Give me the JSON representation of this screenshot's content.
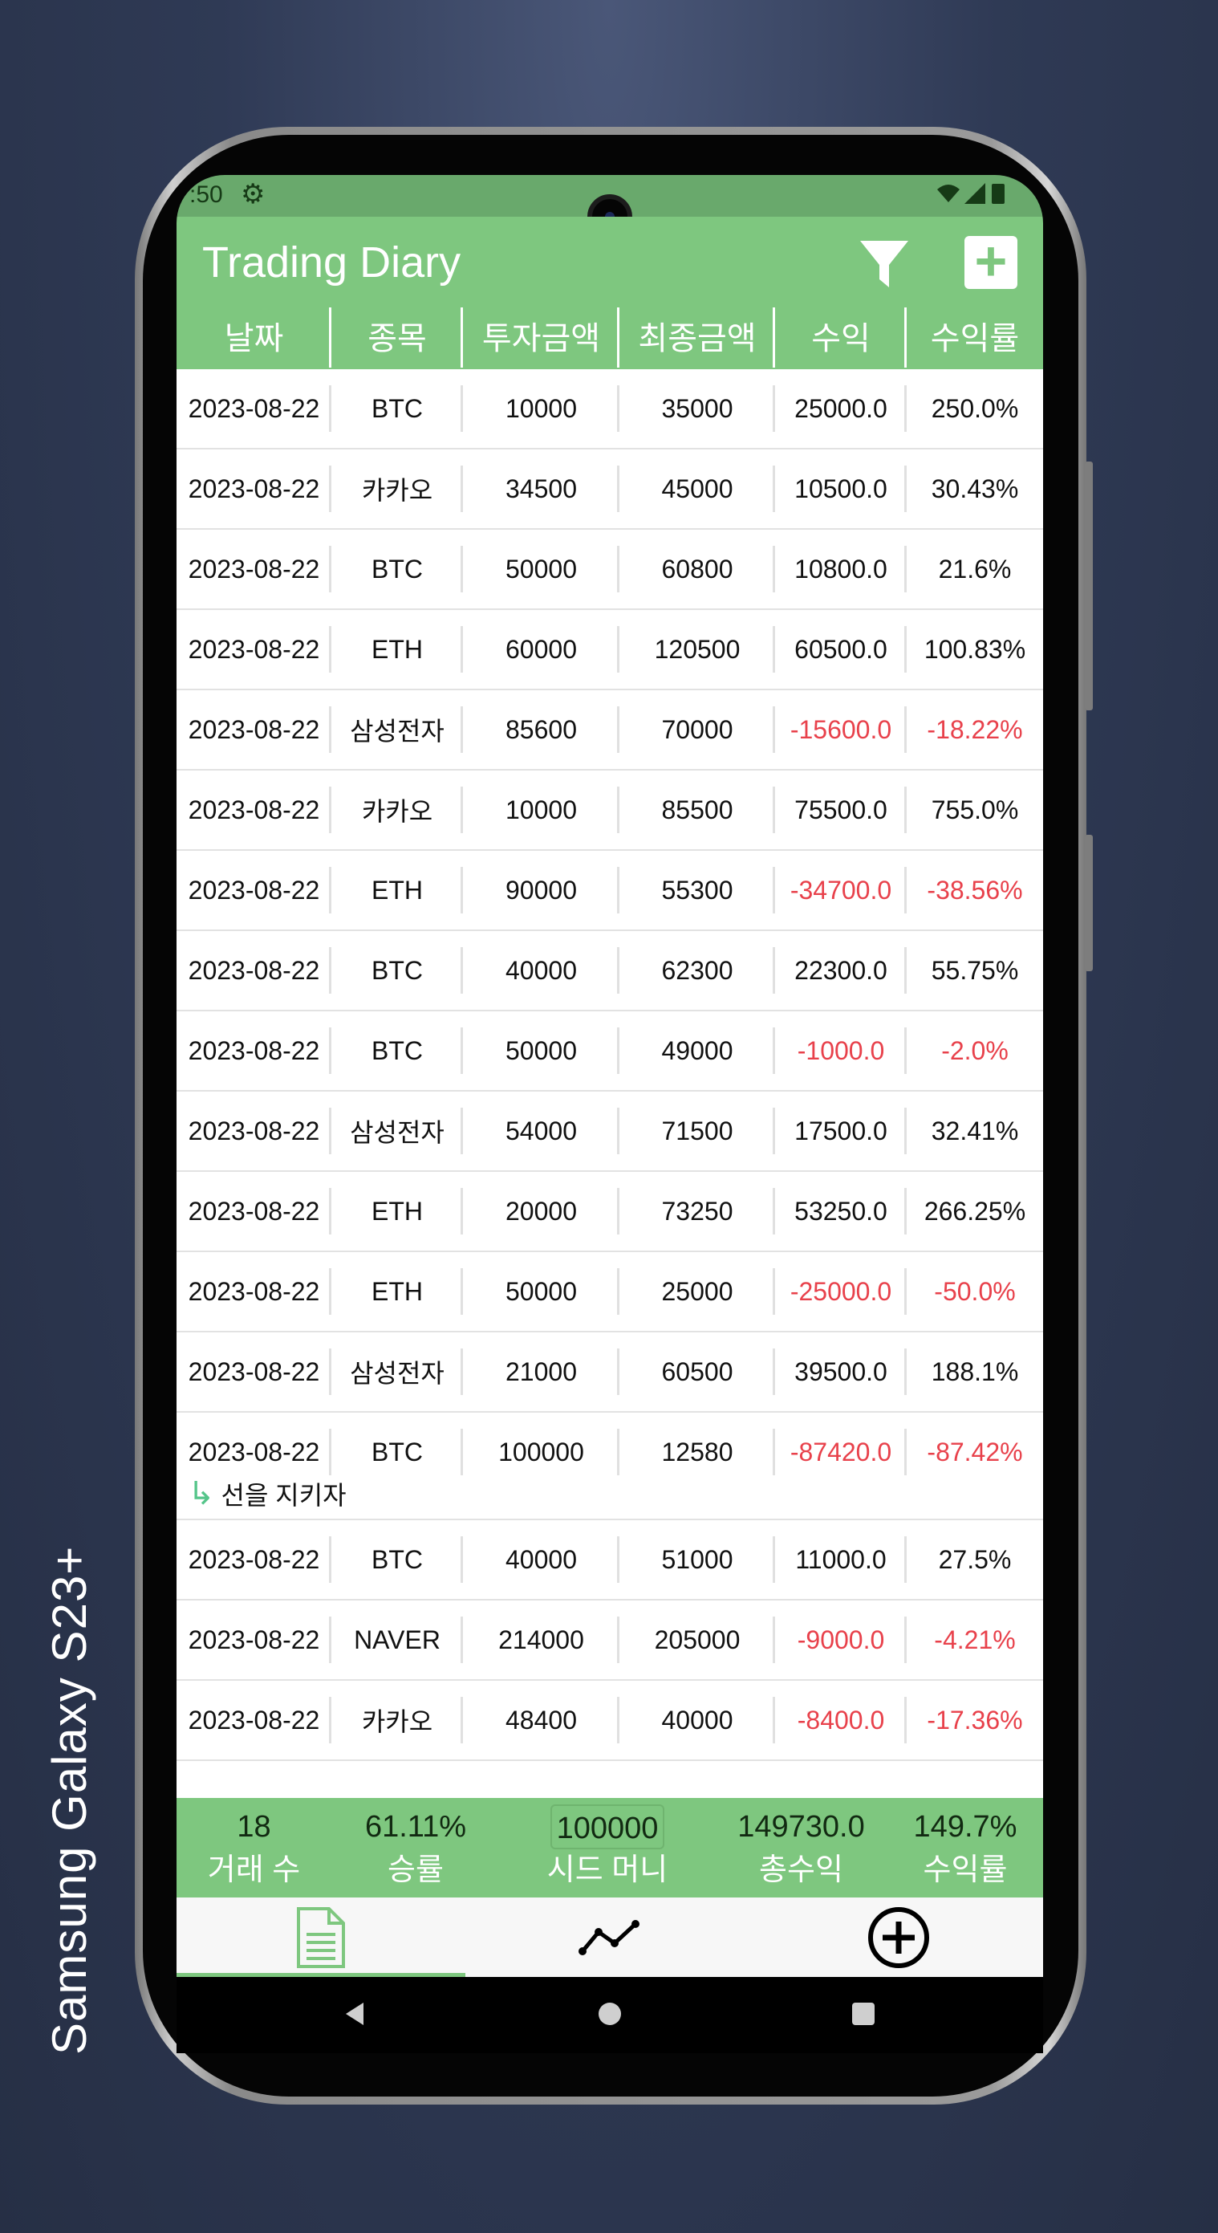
{
  "device_label": "Samsung Galaxy  S23+",
  "status_bar": {
    "time": ":50",
    "gear_icon": "settings-gear-icon",
    "right_icons": "wifi signal battery"
  },
  "app": {
    "title": "Trading Diary",
    "filter_icon": "filter-funnel-icon",
    "add_icon": "add-square-icon"
  },
  "table": {
    "columns": [
      "날짜",
      "종목",
      "투자금액",
      "최종금액",
      "수익",
      "수익률"
    ],
    "rows": [
      {
        "date": "2023-08-22",
        "ticker": "BTC",
        "invest": "10000",
        "final": "35000",
        "profit": "25000.0",
        "rate": "250.0%",
        "negative": false
      },
      {
        "date": "2023-08-22",
        "ticker": "카카오",
        "invest": "34500",
        "final": "45000",
        "profit": "10500.0",
        "rate": "30.43%",
        "negative": false
      },
      {
        "date": "2023-08-22",
        "ticker": "BTC",
        "invest": "50000",
        "final": "60800",
        "profit": "10800.0",
        "rate": "21.6%",
        "negative": false
      },
      {
        "date": "2023-08-22",
        "ticker": "ETH",
        "invest": "60000",
        "final": "120500",
        "profit": "60500.0",
        "rate": "100.83%",
        "negative": false
      },
      {
        "date": "2023-08-22",
        "ticker": "삼성전자",
        "invest": "85600",
        "final": "70000",
        "profit": "-15600.0",
        "rate": "-18.22%",
        "negative": true
      },
      {
        "date": "2023-08-22",
        "ticker": "카카오",
        "invest": "10000",
        "final": "85500",
        "profit": "75500.0",
        "rate": "755.0%",
        "negative": false
      },
      {
        "date": "2023-08-22",
        "ticker": "ETH",
        "invest": "90000",
        "final": "55300",
        "profit": "-34700.0",
        "rate": "-38.56%",
        "negative": true
      },
      {
        "date": "2023-08-22",
        "ticker": "BTC",
        "invest": "40000",
        "final": "62300",
        "profit": "22300.0",
        "rate": "55.75%",
        "negative": false
      },
      {
        "date": "2023-08-22",
        "ticker": "BTC",
        "invest": "50000",
        "final": "49000",
        "profit": "-1000.0",
        "rate": "-2.0%",
        "negative": true
      },
      {
        "date": "2023-08-22",
        "ticker": "삼성전자",
        "invest": "54000",
        "final": "71500",
        "profit": "17500.0",
        "rate": "32.41%",
        "negative": false
      },
      {
        "date": "2023-08-22",
        "ticker": "ETH",
        "invest": "20000",
        "final": "73250",
        "profit": "53250.0",
        "rate": "266.25%",
        "negative": false
      },
      {
        "date": "2023-08-22",
        "ticker": "ETH",
        "invest": "50000",
        "final": "25000",
        "profit": "-25000.0",
        "rate": "-50.0%",
        "negative": true
      },
      {
        "date": "2023-08-22",
        "ticker": "삼성전자",
        "invest": "21000",
        "final": "60500",
        "profit": "39500.0",
        "rate": "188.1%",
        "negative": false
      },
      {
        "date": "2023-08-22",
        "ticker": "BTC",
        "invest": "100000",
        "final": "12580",
        "profit": "-87420.0",
        "rate": "-87.42%",
        "negative": true,
        "memo": "선을 지키자"
      },
      {
        "date": "2023-08-22",
        "ticker": "BTC",
        "invest": "40000",
        "final": "51000",
        "profit": "11000.0",
        "rate": "27.5%",
        "negative": false
      },
      {
        "date": "2023-08-22",
        "ticker": "NAVER",
        "invest": "214000",
        "final": "205000",
        "profit": "-9000.0",
        "rate": "-4.21%",
        "negative": true
      },
      {
        "date": "2023-08-22",
        "ticker": "카카오",
        "invest": "48400",
        "final": "40000",
        "profit": "-8400.0",
        "rate": "-17.36%",
        "negative": true
      }
    ]
  },
  "summary": {
    "trade_count": "18",
    "trade_count_label": "거래 수",
    "win_rate": "61.11%",
    "win_rate_label": "승률",
    "seed_money": "100000",
    "seed_money_label": "시드 머니",
    "total_profit": "149730.0",
    "total_profit_label": "총수익",
    "total_rate": "149.7%",
    "total_rate_label": "수익률"
  },
  "bottom_nav": {
    "items": [
      {
        "icon": "document-list-icon",
        "active": true
      },
      {
        "icon": "line-chart-icon",
        "active": false
      },
      {
        "icon": "add-circle-icon",
        "active": false
      }
    ]
  },
  "colors": {
    "primary": "#7ec77f",
    "negative": "#e8414b",
    "status_bar": "#69a96c"
  }
}
